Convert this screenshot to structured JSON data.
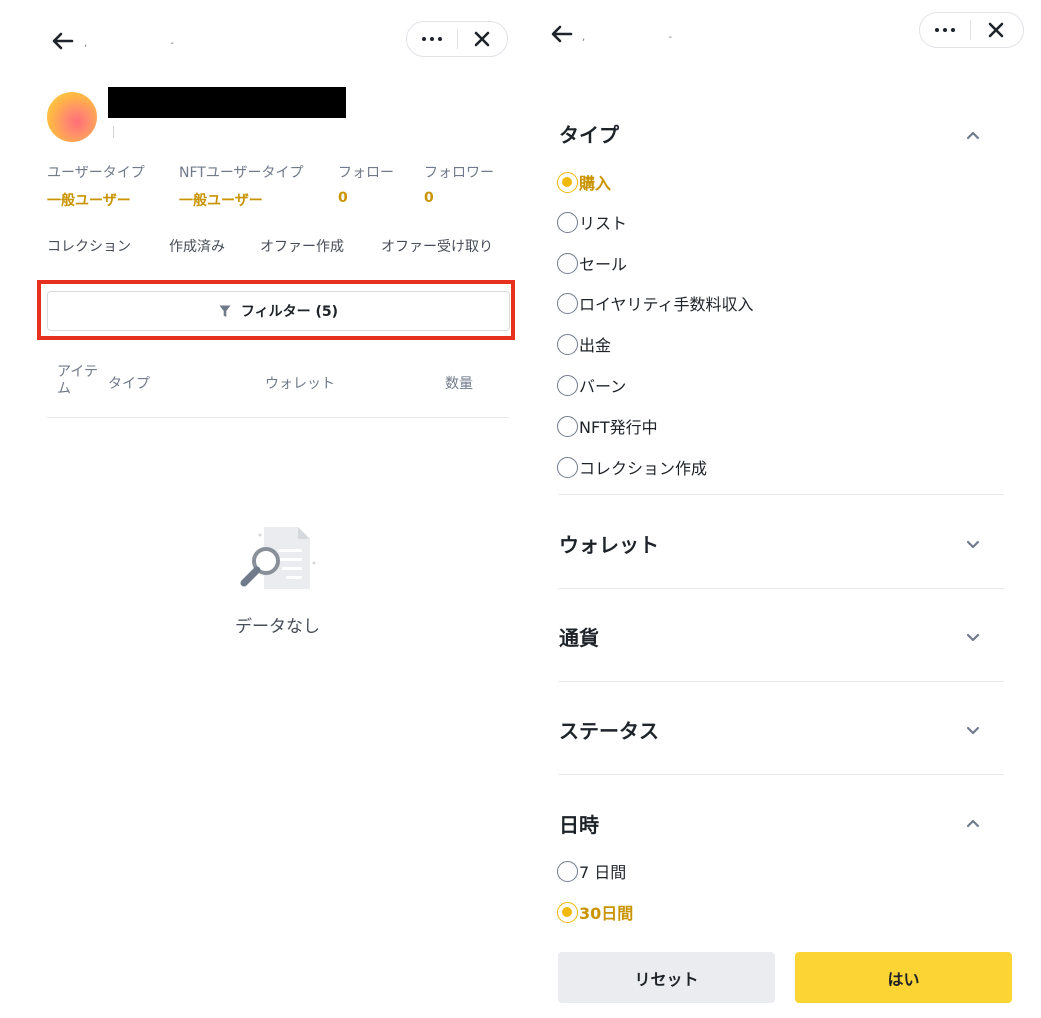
{
  "left": {
    "stats": [
      {
        "label": "ユーザータイプ",
        "value": "一般ユーザー"
      },
      {
        "label": "NFTユーザータイプ",
        "value": "一般ユーザー"
      },
      {
        "label": "フォロー",
        "value": "0"
      },
      {
        "label": "フォロワー",
        "value": "0"
      }
    ],
    "tabs": [
      "コレクション",
      "作成済み",
      "オファー作成",
      "オファー受け取り"
    ],
    "filter_label": "フィルター (5)",
    "columns": [
      "アイテ\nム",
      "タイプ",
      "ウォレット",
      "数量"
    ],
    "empty_text": "データなし"
  },
  "right": {
    "sections": {
      "type": {
        "title": "タイプ",
        "expanded": true,
        "options": [
          "購入",
          "リスト",
          "セール",
          "ロイヤリティ手数料収入",
          "出金",
          "バーン",
          "NFT発行中",
          "コレクション作成"
        ],
        "selected": "購入"
      },
      "wallet": {
        "title": "ウォレット",
        "expanded": false
      },
      "currency": {
        "title": "通貨",
        "expanded": false
      },
      "status": {
        "title": "ステータス",
        "expanded": false
      },
      "date": {
        "title": "日時",
        "expanded": true,
        "options": [
          "7 日間",
          "30日間"
        ],
        "selected": "30日間"
      }
    },
    "buttons": {
      "reset": "リセット",
      "ok": "はい"
    }
  },
  "colors": {
    "accent": "#f0b90b",
    "accent_text": "#c99400",
    "highlight": "#e8301f",
    "primary_button": "#fcd535",
    "secondary_button": "#eaecef"
  },
  "icons": [
    "back-arrow-icon",
    "more-dots-icon",
    "close-icon",
    "filter-funnel-icon",
    "search-document-icon",
    "chevron-up-icon",
    "chevron-down-icon"
  ]
}
